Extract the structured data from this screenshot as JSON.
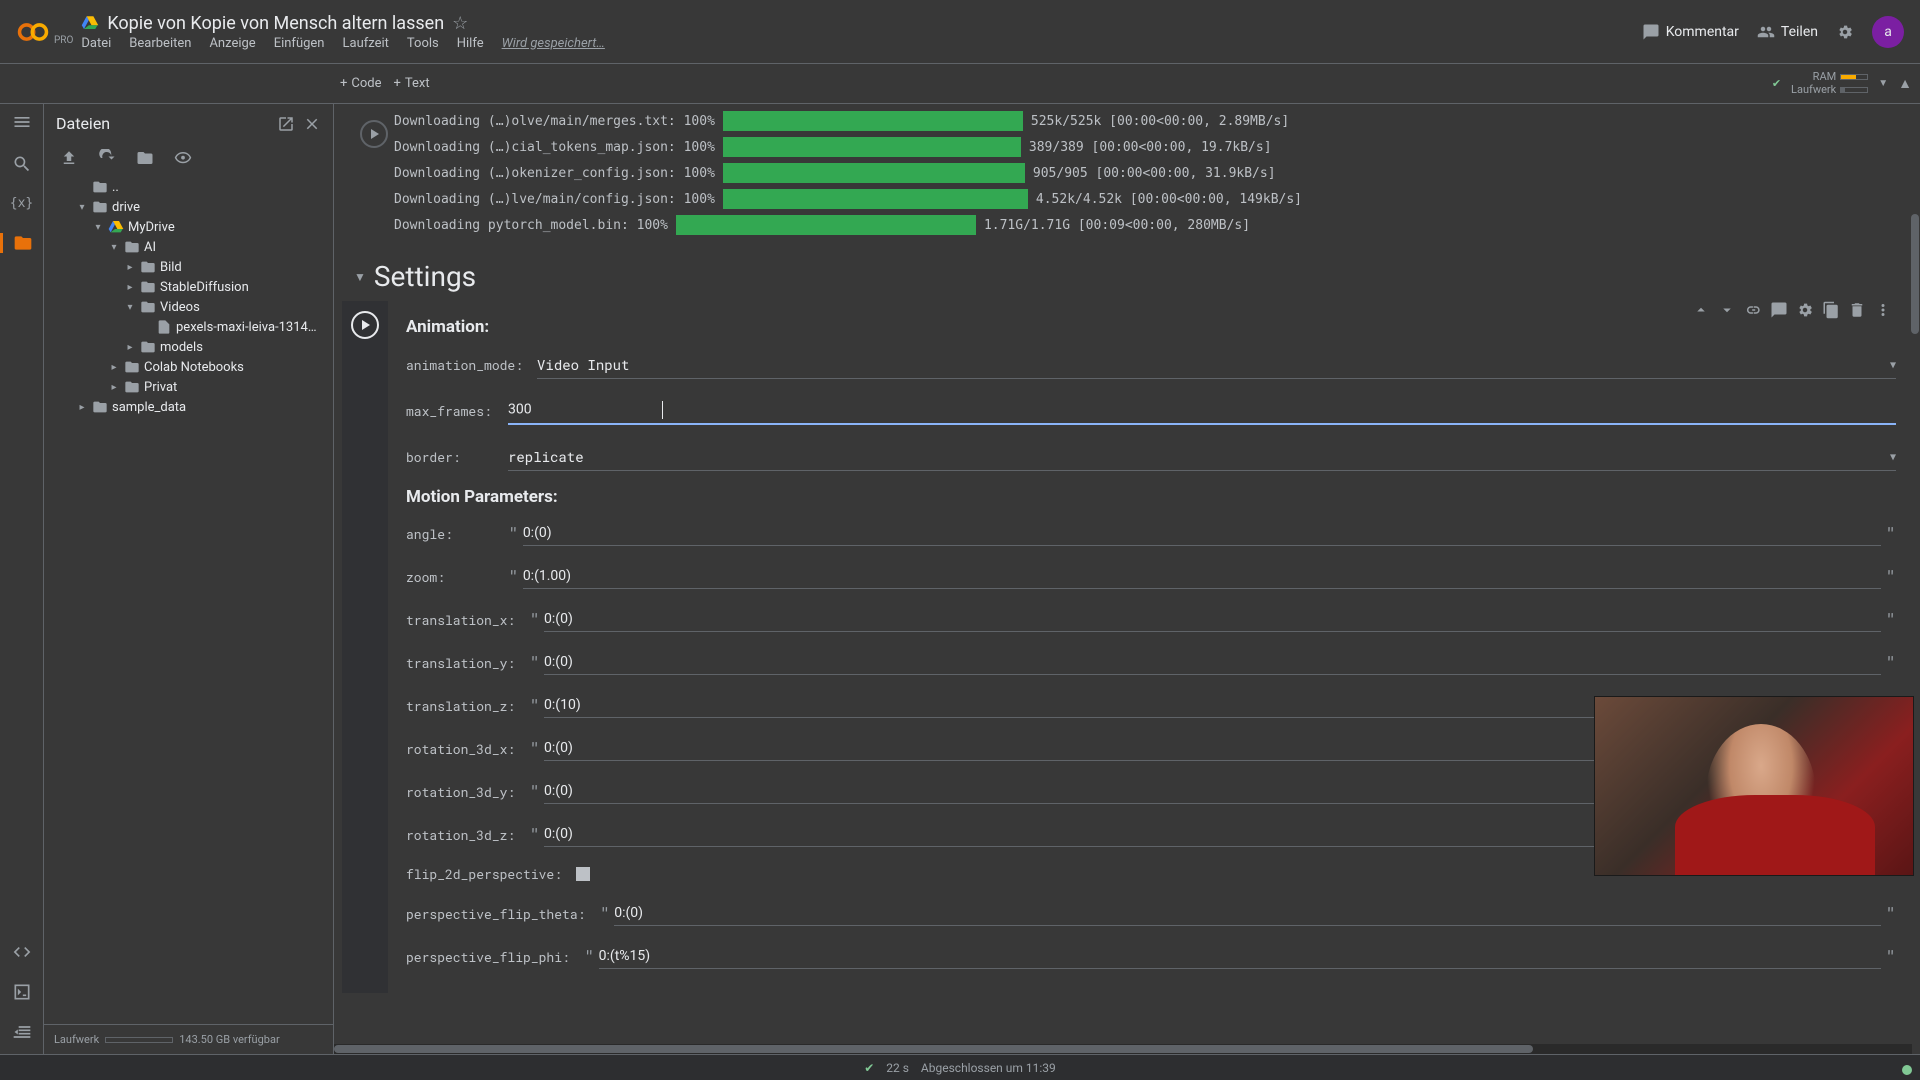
{
  "header": {
    "pro": "PRO",
    "doc_title": "Kopie von Kopie von Mensch altern lassen",
    "menu": [
      "Datei",
      "Bearbeiten",
      "Anzeige",
      "Einfügen",
      "Laufzeit",
      "Tools",
      "Hilfe"
    ],
    "saving": "Wird gespeichert…",
    "kommentar": "Kommentar",
    "teilen": "Teilen",
    "avatar": "a"
  },
  "toolbar": {
    "code": "Code",
    "text": "Text",
    "ram": "RAM",
    "laufwerk": "Laufwerk"
  },
  "files_panel": {
    "title": "Dateien",
    "tree": {
      "up": "..",
      "drive": "drive",
      "mydrive": "MyDrive",
      "ai": "AI",
      "bild": "Bild",
      "sd": "StableDiffusion",
      "videos": "Videos",
      "pexels": "pexels-maxi-leiva-1314…",
      "models": "models",
      "colab_nb": "Colab Notebooks",
      "privat": "Privat",
      "sample": "sample_data"
    },
    "footer_label": "Laufwerk",
    "footer_free": "143.50 GB verfügbar"
  },
  "downloads": [
    {
      "label": "Downloading (…)olve/main/merges.txt:",
      "pct": "100%",
      "bar": 300,
      "info": "525k/525k [00:00<00:00, 2.89MB/s]"
    },
    {
      "label": "Downloading (…)cial_tokens_map.json:",
      "pct": "100%",
      "bar": 298,
      "info": "389/389 [00:00<00:00, 19.7kB/s]"
    },
    {
      "label": "Downloading (…)okenizer_config.json:",
      "pct": "100%",
      "bar": 302,
      "info": "905/905 [00:00<00:00, 31.9kB/s]"
    },
    {
      "label": "Downloading (…)lve/main/config.json:",
      "pct": "100%",
      "bar": 305,
      "info": "4.52k/4.52k [00:00<00:00, 149kB/s]"
    },
    {
      "label": "Downloading pytorch_model.bin:",
      "pct": "100%",
      "bar": 300,
      "info": "1.71G/1.71G [00:09<00:00, 280MB/s]"
    }
  ],
  "section_title": "Settings",
  "form": {
    "animation_h": "Animation:",
    "animation_mode_l": "animation_mode:",
    "animation_mode_v": "Video Input",
    "max_frames_l": "max_frames:",
    "max_frames_v": "300",
    "border_l": "border:",
    "border_v": "replicate",
    "motion_h": "Motion Parameters:",
    "angle_l": "angle:",
    "angle_v": "0:(0)",
    "zoom_l": "zoom:",
    "zoom_v": "0:(1.00)",
    "tx_l": "translation_x:",
    "tx_v": "0:(0)",
    "ty_l": "translation_y:",
    "ty_v": "0:(0)",
    "tz_l": "translation_z:",
    "tz_v": "0:(10)",
    "rx_l": "rotation_3d_x:",
    "rx_v": "0:(0)",
    "ry_l": "rotation_3d_y:",
    "ry_v": "0:(0)",
    "rz_l": "rotation_3d_z:",
    "rz_v": "0:(0)",
    "flip_l": "flip_2d_perspective:",
    "pft_l": "perspective_flip_theta:",
    "pft_v": "0:(0)",
    "pfp_l": "perspective_flip_phi:",
    "pfp_v": "0:(t%15)"
  },
  "status": {
    "time": "22 s",
    "done": "Abgeschlossen um 11:39"
  }
}
